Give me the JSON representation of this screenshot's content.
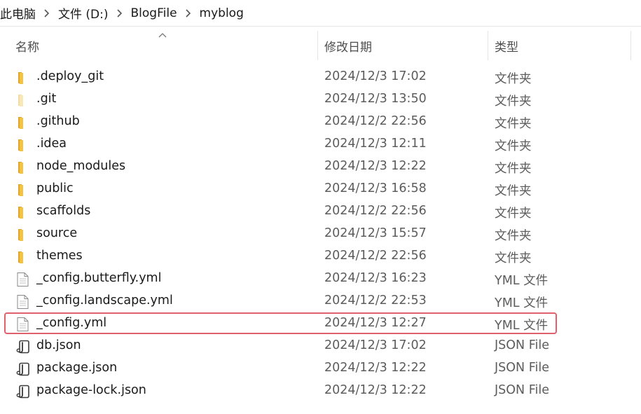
{
  "breadcrumb": {
    "items": [
      "此电脑",
      "文件 (D:)",
      "BlogFile",
      "myblog"
    ]
  },
  "columns": {
    "name": "名称",
    "date": "修改日期",
    "type": "类型",
    "sorted_by": "name"
  },
  "files": [
    {
      "name": ".deploy_git",
      "date": "2024/12/3 17:02",
      "type": "文件夹",
      "icon": "folder-icon"
    },
    {
      "name": ".git",
      "date": "2024/12/3 13:50",
      "type": "文件夹",
      "icon": "folder-icon-faded"
    },
    {
      "name": ".github",
      "date": "2024/12/2 22:56",
      "type": "文件夹",
      "icon": "folder-icon"
    },
    {
      "name": ".idea",
      "date": "2024/12/3 12:11",
      "type": "文件夹",
      "icon": "folder-icon"
    },
    {
      "name": "node_modules",
      "date": "2024/12/3 12:22",
      "type": "文件夹",
      "icon": "folder-icon"
    },
    {
      "name": "public",
      "date": "2024/12/3 16:58",
      "type": "文件夹",
      "icon": "folder-icon"
    },
    {
      "name": "scaffolds",
      "date": "2024/12/2 22:56",
      "type": "文件夹",
      "icon": "folder-icon"
    },
    {
      "name": "source",
      "date": "2024/12/3 15:57",
      "type": "文件夹",
      "icon": "folder-icon"
    },
    {
      "name": "themes",
      "date": "2024/12/2 22:56",
      "type": "文件夹",
      "icon": "folder-icon"
    },
    {
      "name": "_config.butterfly.yml",
      "date": "2024/12/3 16:23",
      "type": "YML 文件",
      "icon": "document-icon"
    },
    {
      "name": "_config.landscape.yml",
      "date": "2024/12/2 22:53",
      "type": "YML 文件",
      "icon": "document-icon"
    },
    {
      "name": "_config.yml",
      "date": "2024/12/3 12:27",
      "type": "YML 文件",
      "icon": "document-icon",
      "highlighted": true
    },
    {
      "name": "db.json",
      "date": "2024/12/3 17:02",
      "type": "JSON File",
      "icon": "json-file-icon"
    },
    {
      "name": "package.json",
      "date": "2024/12/3 12:22",
      "type": "JSON File",
      "icon": "json-file-icon"
    },
    {
      "name": "package-lock.json",
      "date": "2024/12/3 12:22",
      "type": "JSON File",
      "icon": "json-file-icon"
    }
  ],
  "colors": {
    "highlight_border": "#e0606e",
    "folder_yellow": "#f5c242",
    "folder_dark": "#e2a52b"
  }
}
